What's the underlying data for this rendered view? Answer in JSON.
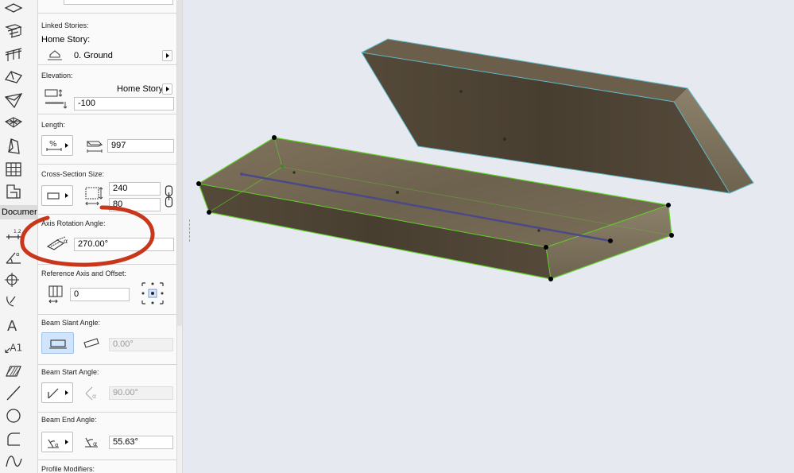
{
  "toolbox": {
    "document_label": "Documer",
    "icons": [
      "slab-icon",
      "stair-icon",
      "railing-icon",
      "roof-icon",
      "shell-icon",
      "mesh-icon",
      "morph-icon",
      "curtain-wall-icon",
      "object-icon",
      "dimension-icon",
      "angle-dimension-icon",
      "level-dimension-icon",
      "radial-dimension-icon",
      "text-icon",
      "label-icon",
      "fill-icon",
      "line-icon",
      "circle-icon",
      "polyline-icon",
      "spline-icon"
    ],
    "dim_small_label": "1.2",
    "text_tool_glyph": "A",
    "label_tool_text": "A1"
  },
  "panel": {
    "linked_stories": {
      "title": "Linked Stories:",
      "home_story_label": "Home Story:",
      "home_story_value": "0. Ground"
    },
    "elevation": {
      "title": "Elevation:",
      "reference": "Home Story",
      "value": "-100"
    },
    "length": {
      "title": "Length:",
      "value": "997"
    },
    "cross_section": {
      "title": "Cross-Section Size:",
      "width": "240",
      "height": "80"
    },
    "axis_rotation": {
      "title": "Axis Rotation Angle:",
      "value": "270.00°"
    },
    "reference_axis": {
      "title": "Reference Axis and Offset:",
      "value": "0"
    },
    "slant_angle": {
      "title": "Beam Slant Angle:",
      "value": "0.00°"
    },
    "start_angle": {
      "title": "Beam Start Angle:",
      "value": "90.00°"
    },
    "end_angle": {
      "title": "Beam End Angle:",
      "value": "55.63°"
    },
    "profile_modifiers": {
      "title": "Profile Modifiers:"
    }
  },
  "colors": {
    "highlight_ring": "#c8361c",
    "selection_edge": "#5fd02a",
    "beam_axis": "#4c4a86",
    "wood_light": "#7c6d56",
    "wood_dark": "#4a3f30",
    "background": "#e6e9f0"
  }
}
